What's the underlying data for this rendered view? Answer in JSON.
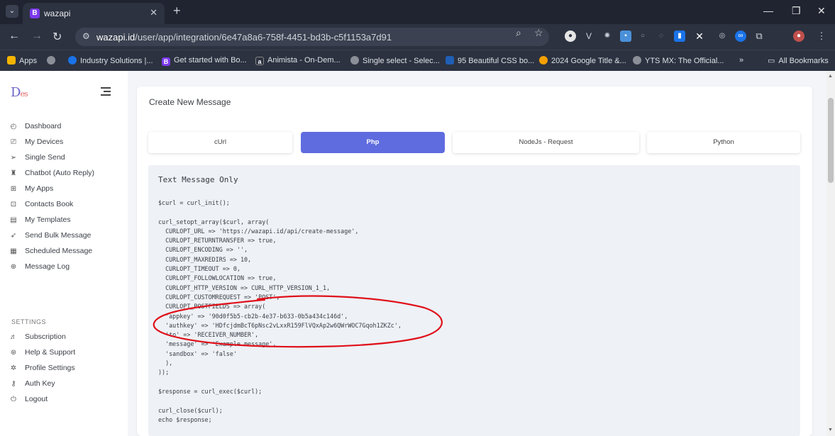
{
  "browser": {
    "tab_title": "wazapi",
    "tab_favicon_letter": "B",
    "url_host": "wazapi.id",
    "url_path": "/user/app/integration/6e47a8a6-758f-4451-bd3b-c5f1153a7d91",
    "bookmarks": [
      {
        "label": "Apps",
        "color": "#f5b400"
      },
      {
        "label": "",
        "color": "#8a8f98"
      },
      {
        "label": "Industry Solutions |...",
        "color": "#1a73e8"
      },
      {
        "label": "Get started with Bo...",
        "color": "#7c3aed"
      },
      {
        "label": "Animista - On-Dem...",
        "color": "#2c3240"
      },
      {
        "label": "Single select - Selec...",
        "color": "#8a8f98"
      },
      {
        "label": "95 Beautiful CSS bo...",
        "color": "#1f5fb5"
      },
      {
        "label": "2024 Google Title &...",
        "color": "#f5a000"
      },
      {
        "label": "YTS MX: The Official...",
        "color": "#8a8f98"
      }
    ],
    "bookmarks_overflow": "»",
    "all_bookmarks": "All Bookmarks"
  },
  "sidebar": {
    "logo_text": "D",
    "logo_suffix": "es",
    "items": [
      {
        "label": "Dashboard",
        "icon": "speedometer-icon"
      },
      {
        "label": "My Devices",
        "icon": "device-icon"
      },
      {
        "label": "Single Send",
        "icon": "send-icon"
      },
      {
        "label": "Chatbot (Auto Reply)",
        "icon": "robot-icon"
      },
      {
        "label": "My Apps",
        "icon": "apps-icon"
      },
      {
        "label": "Contacts Book",
        "icon": "contacts-icon"
      },
      {
        "label": "My Templates",
        "icon": "template-icon"
      },
      {
        "label": "Send Bulk Message",
        "icon": "rocket-icon"
      },
      {
        "label": "Scheduled Message",
        "icon": "calendar-icon"
      },
      {
        "label": "Message Log",
        "icon": "log-icon"
      }
    ],
    "settings_label": "SETTINGS",
    "settings_items": [
      {
        "label": "Subscription",
        "icon": "subscription-icon"
      },
      {
        "label": "Help & Support",
        "icon": "help-icon"
      },
      {
        "label": "Profile Settings",
        "icon": "gear-icon"
      },
      {
        "label": "Auth Key",
        "icon": "key-icon"
      },
      {
        "label": "Logout",
        "icon": "power-icon"
      }
    ]
  },
  "main": {
    "title": "Create New Message",
    "tabs": [
      {
        "label": "cUrl",
        "active": false
      },
      {
        "label": "Php",
        "active": true
      },
      {
        "label": "NodeJs - Request",
        "active": false
      },
      {
        "label": "Python",
        "active": false
      }
    ],
    "code_heading": "Text Message Only",
    "code_lines": [
      "$curl = curl_init();",
      "",
      "curl_setopt_array($curl, array(",
      "  CURLOPT_URL => 'https://wazapi.id/api/create-message',",
      "  CURLOPT_RETURNTRANSFER => true,",
      "  CURLOPT_ENCODING => '',",
      "  CURLOPT_MAXREDIRS => 10,",
      "  CURLOPT_TIMEOUT => 0,",
      "  CURLOPT_FOLLOWLOCATION => true,",
      "  CURLOPT_HTTP_VERSION => CURL_HTTP_VERSION_1_1,",
      "  CURLOPT_CUSTOMREQUEST => 'POST',",
      "  CURLOPT_POSTFIELDS => array(",
      "  'appkey' => '90d0f5b5-cb2b-4e37-b633-0b5a434c146d',",
      "  'authkey' => 'HDfcjdmBcT6pNsc2vLxxR159FlVQxAp2w6QWrWOC7Gqoh1ZKZc',",
      "  'to' => 'RECEIVER_NUMBER',",
      "  'message' => 'Example message',",
      "  'sandbox' => 'false'",
      "  ),",
      "));",
      "",
      "$response = curl_exec($curl);",
      "",
      "curl_close($curl);",
      "echo $response;"
    ],
    "annotation_color": "#e0101a"
  }
}
